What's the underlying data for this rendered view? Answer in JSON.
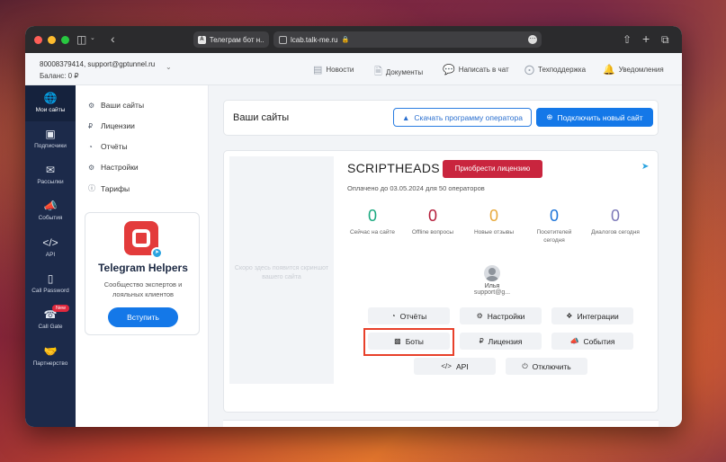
{
  "browser": {
    "tab_title": "Телеграм бот н...",
    "url": "lcab.talk-me.ru"
  },
  "header": {
    "account": "80008379414, support@gptunnel.ru",
    "balance": "Баланс: 0 ₽",
    "nav": [
      {
        "label": "Новости",
        "icon": "list-icon"
      },
      {
        "label": "Документы",
        "icon": "document-icon"
      },
      {
        "label": "Написать в чат",
        "icon": "chat-icon"
      },
      {
        "label": "Техподдержка",
        "icon": "lifebuoy-icon"
      },
      {
        "label": "Уведомления",
        "icon": "bell-icon"
      }
    ]
  },
  "sidebar": {
    "items": [
      {
        "label": "Мои сайты",
        "icon": "globe-icon",
        "active": true
      },
      {
        "label": "Подписчики",
        "icon": "contacts-icon"
      },
      {
        "label": "Рассылки",
        "icon": "mail-icon"
      },
      {
        "label": "События",
        "icon": "megaphone-icon"
      },
      {
        "label": "API",
        "icon": "code-icon"
      },
      {
        "label": "Call Password",
        "icon": "device-icon"
      },
      {
        "label": "Call Gate",
        "icon": "phone-icon",
        "badge": "New"
      },
      {
        "label": "Партнерство",
        "icon": "handshake-icon"
      }
    ]
  },
  "sub_sidebar": {
    "items": [
      {
        "label": "Ваши сайты",
        "icon": "globe-icon"
      },
      {
        "label": "Лицензии",
        "icon": "ruble-icon"
      },
      {
        "label": "Отчёты",
        "icon": "gauge-icon"
      },
      {
        "label": "Настройки",
        "icon": "gear-icon"
      },
      {
        "label": "Тарифы",
        "icon": "info-icon"
      }
    ],
    "promo": {
      "title": "Telegram Helpers",
      "description": "Сообщество экспертов и лояльных клиентов",
      "button": "Вступить"
    }
  },
  "main": {
    "title": "Ваши сайты",
    "download_button": "Скачать программу оператора",
    "connect_button": "Подключить новый сайт",
    "site": {
      "name": "SCRIPTHEADS",
      "license_button": "Приобрести лицензию",
      "paid_text": "Оплачено до 03.05.2024 для 50 операторов",
      "placeholder": "Скоро здесь появится скриншот вашего сайта",
      "stats": [
        {
          "value": "0",
          "label": "Сейчас на сайте",
          "color": "#1aa97f"
        },
        {
          "value": "0",
          "label": "Offline вопросы",
          "color": "#b51d3a"
        },
        {
          "value": "0",
          "label": "Новые отзывы",
          "color": "#e8a93b"
        },
        {
          "value": "0",
          "label": "Посетителей сегодня",
          "color": "#1c74d9"
        },
        {
          "value": "0",
          "label": "Диалогов сегодня",
          "color": "#7c78b8"
        }
      ],
      "operator": {
        "name": "Илья",
        "email": "support@g..."
      },
      "actions": {
        "reports": "Отчёты",
        "settings": "Настройки",
        "integrations": "Интеграции",
        "bots": "Боты",
        "license": "Лицензия",
        "events": "События",
        "api": "API",
        "disable": "Отключить"
      }
    }
  },
  "colors": {
    "sidebar": "#1c2a4a",
    "primary": "#1478e8",
    "license": "#c9253e",
    "annotation": "#e8402a"
  }
}
